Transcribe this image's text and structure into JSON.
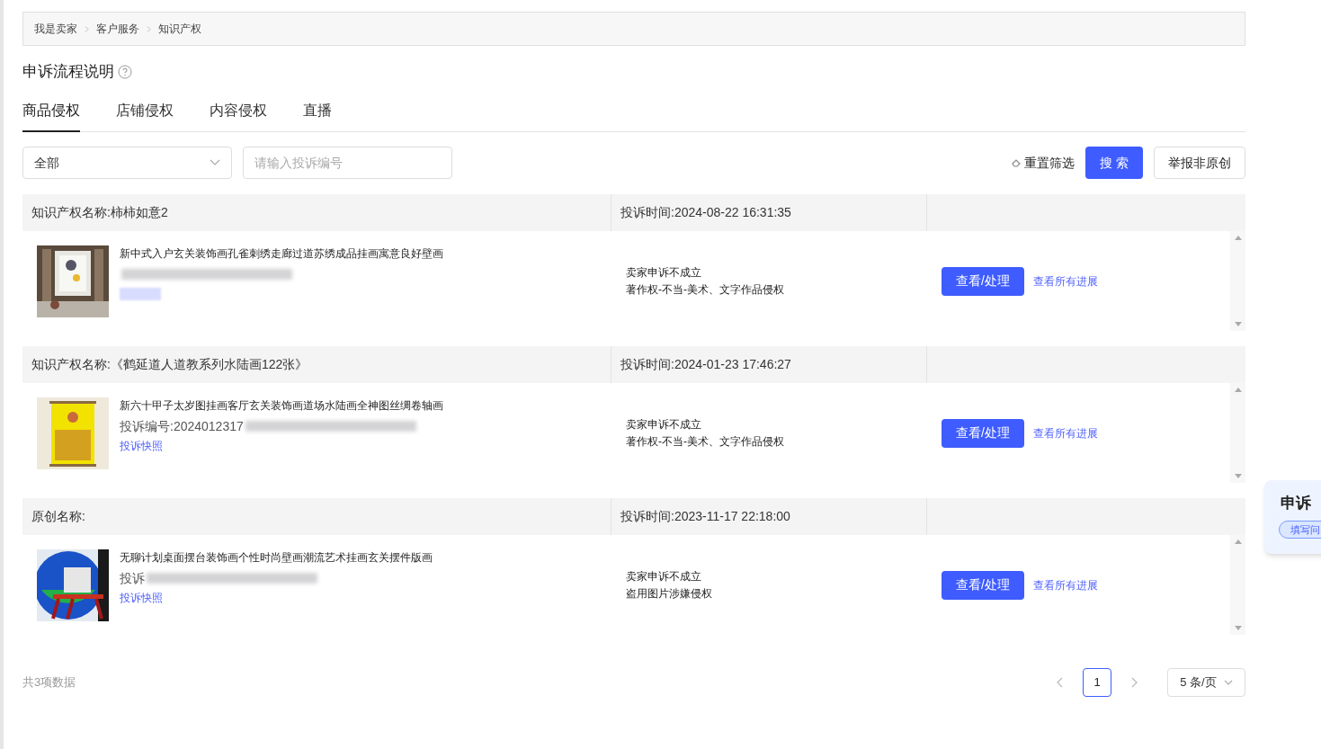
{
  "breadcrumb": [
    "我是卖家",
    "客户服务",
    "知识产权"
  ],
  "page_title": "申诉流程说明",
  "tabs": [
    {
      "label": "商品侵权",
      "selected": true
    },
    {
      "label": "店铺侵权",
      "selected": false
    },
    {
      "label": "内容侵权",
      "selected": false
    },
    {
      "label": "直播",
      "selected": false
    }
  ],
  "filters": {
    "type_select": "全部",
    "search": {
      "placeholder": "请输入投诉编号"
    },
    "reset": "重置筛选",
    "search_button": "搜 索",
    "report_button": "举报非原创"
  },
  "complaints": [
    {
      "ip_name": "知识产权名称:柿柿如意2",
      "time": "投诉时间:2024-08-22 16:31:35",
      "product": "新中式入户玄关装饰画孔雀刺绣走廊过道苏绣成品挂画寓意良好壁画",
      "status": "卖家申诉不成立",
      "reason": "著作权-不当-美术、文字作品侵权",
      "action": "查看/处理",
      "progress": "查看所有进展"
    },
    {
      "ip_name": "知识产权名称:《鹤延道人道教系列水陆画122张》",
      "time": "投诉时间:2024-01-23 17:46:27",
      "product": "新六十甲子太岁图挂画客厅玄关装饰画道场水陆画全神图丝绸卷轴画",
      "complaint_no": "投诉编号:2024012317",
      "snapshot": "投诉快照",
      "status": "卖家申诉不成立",
      "reason": "著作权-不当-美术、文字作品侵权",
      "action": "查看/处理",
      "progress": "查看所有进展"
    },
    {
      "ip_name": "原创名称:",
      "time": "投诉时间:2023-11-17 22:18:00",
      "product": "无聊计划桌面摆台装饰画个性时尚壁画潮流艺术挂画玄关摆件版画",
      "complaint_no": "投诉",
      "snapshot": "投诉快照",
      "status": "卖家申诉不成立",
      "reason": "盗用图片涉嫌侵权",
      "action": "查看/处理",
      "progress": "查看所有进展"
    }
  ],
  "footer": {
    "total": "共3项数据",
    "pages": [
      {
        "label": "1",
        "selected": true
      }
    ],
    "page_size": "5 条/页"
  },
  "float_widget": {
    "title": "申诉",
    "button": "填写问"
  }
}
